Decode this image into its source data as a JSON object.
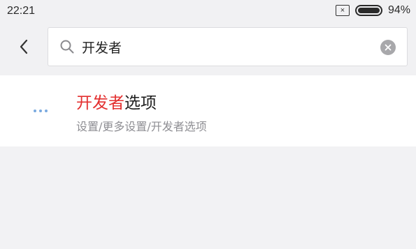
{
  "status_bar": {
    "time": "22:21",
    "battery_percent": "94%",
    "battery_level": 0.94,
    "sim_icon": "sim-icon",
    "battery_icon": "battery-icon"
  },
  "header": {
    "back_icon": "chevron-left-icon",
    "search": {
      "icon": "search-icon",
      "value": "开发者",
      "clear_icon": "clear-icon"
    }
  },
  "results": [
    {
      "icon": "more-icon",
      "title_highlight": "开发者",
      "title_rest": "选项",
      "path": "设置/更多设置/开发者选项"
    }
  ],
  "colors": {
    "highlight": "#e32f2f",
    "background": "#f2f2f4",
    "result_background": "#ffffff",
    "dots": "#7aaae0"
  }
}
